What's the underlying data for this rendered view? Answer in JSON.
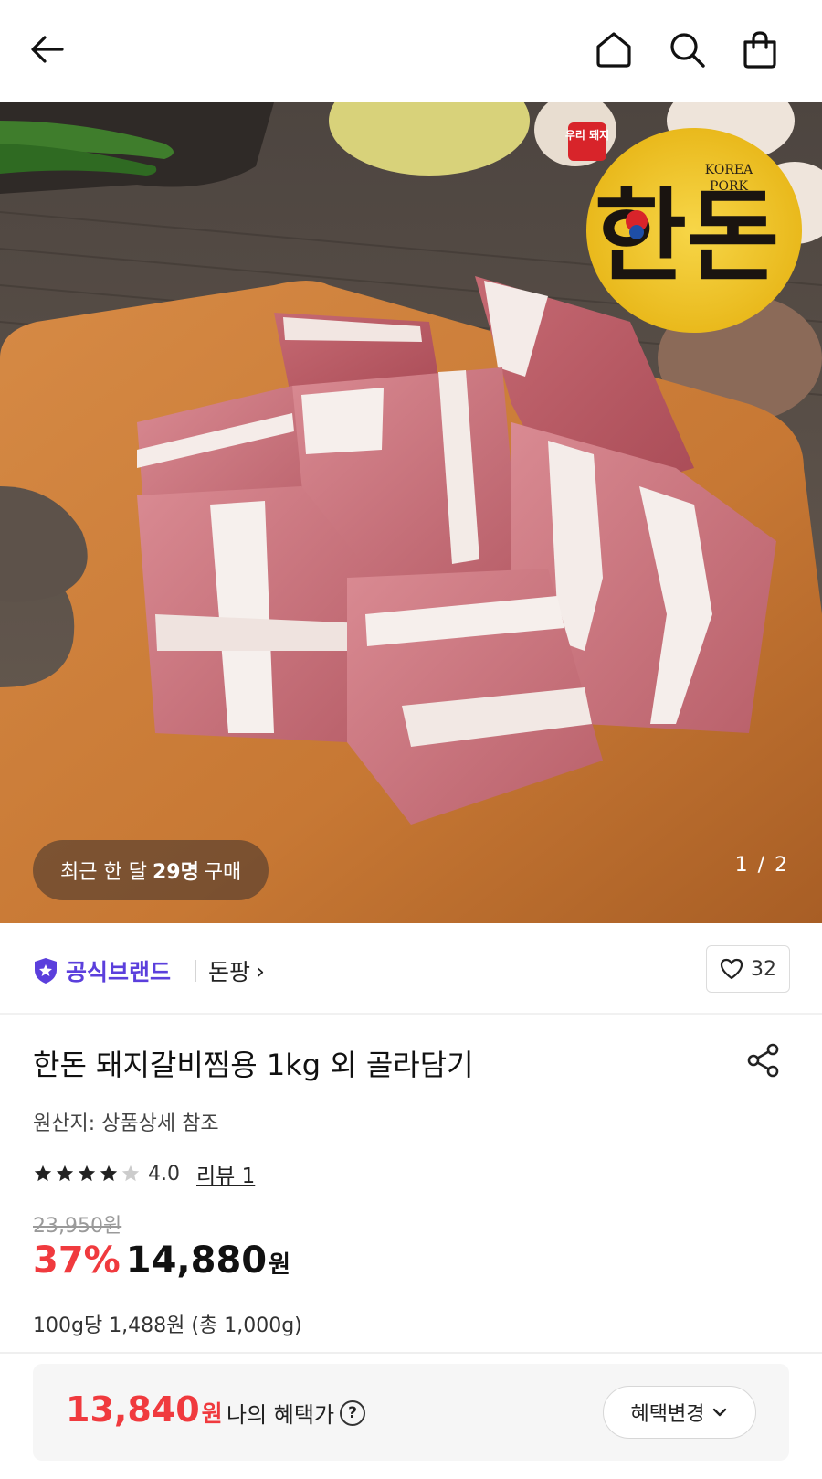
{
  "header": {
    "back_icon": "arrow-left-icon",
    "home_icon": "home-icon",
    "search_icon": "search-icon",
    "cart_icon": "shopping-bag-icon"
  },
  "hero": {
    "recent_prefix": "최근 한 달",
    "recent_count": "29명",
    "recent_suffix": "구매",
    "page_indicator": "1 / 2",
    "logo": {
      "badge_text": "우리 돼지",
      "korean_text": "한돈",
      "english_line1": "KOREA",
      "english_line2": "PORK"
    }
  },
  "brand": {
    "official_label": "공식브랜드",
    "store_name": "돈팡",
    "store_chevron": "›",
    "like_count": "32"
  },
  "product": {
    "title": "한돈 돼지갈비찜용 1kg 외 골라담기",
    "origin": "원산지: 상품상세 참조",
    "rating": "4.0",
    "rating_value": 4.0,
    "review_link": "리뷰 1",
    "original_price": "23,950원",
    "discount": "37%",
    "price": "14,880",
    "price_unit": "원",
    "unit_price": "100g당 1,488원 (총 1,000g)"
  },
  "benefit": {
    "price": "13,840",
    "price_unit": "원",
    "label": "나의 혜택가",
    "help_glyph": "?",
    "button_label": "혜택변경",
    "button_chevron": "⌄"
  },
  "colors": {
    "accent_red": "#f03a3e",
    "brand_purple": "#5b3fdc",
    "star_filled": "#222222",
    "star_empty": "#cccccc"
  }
}
